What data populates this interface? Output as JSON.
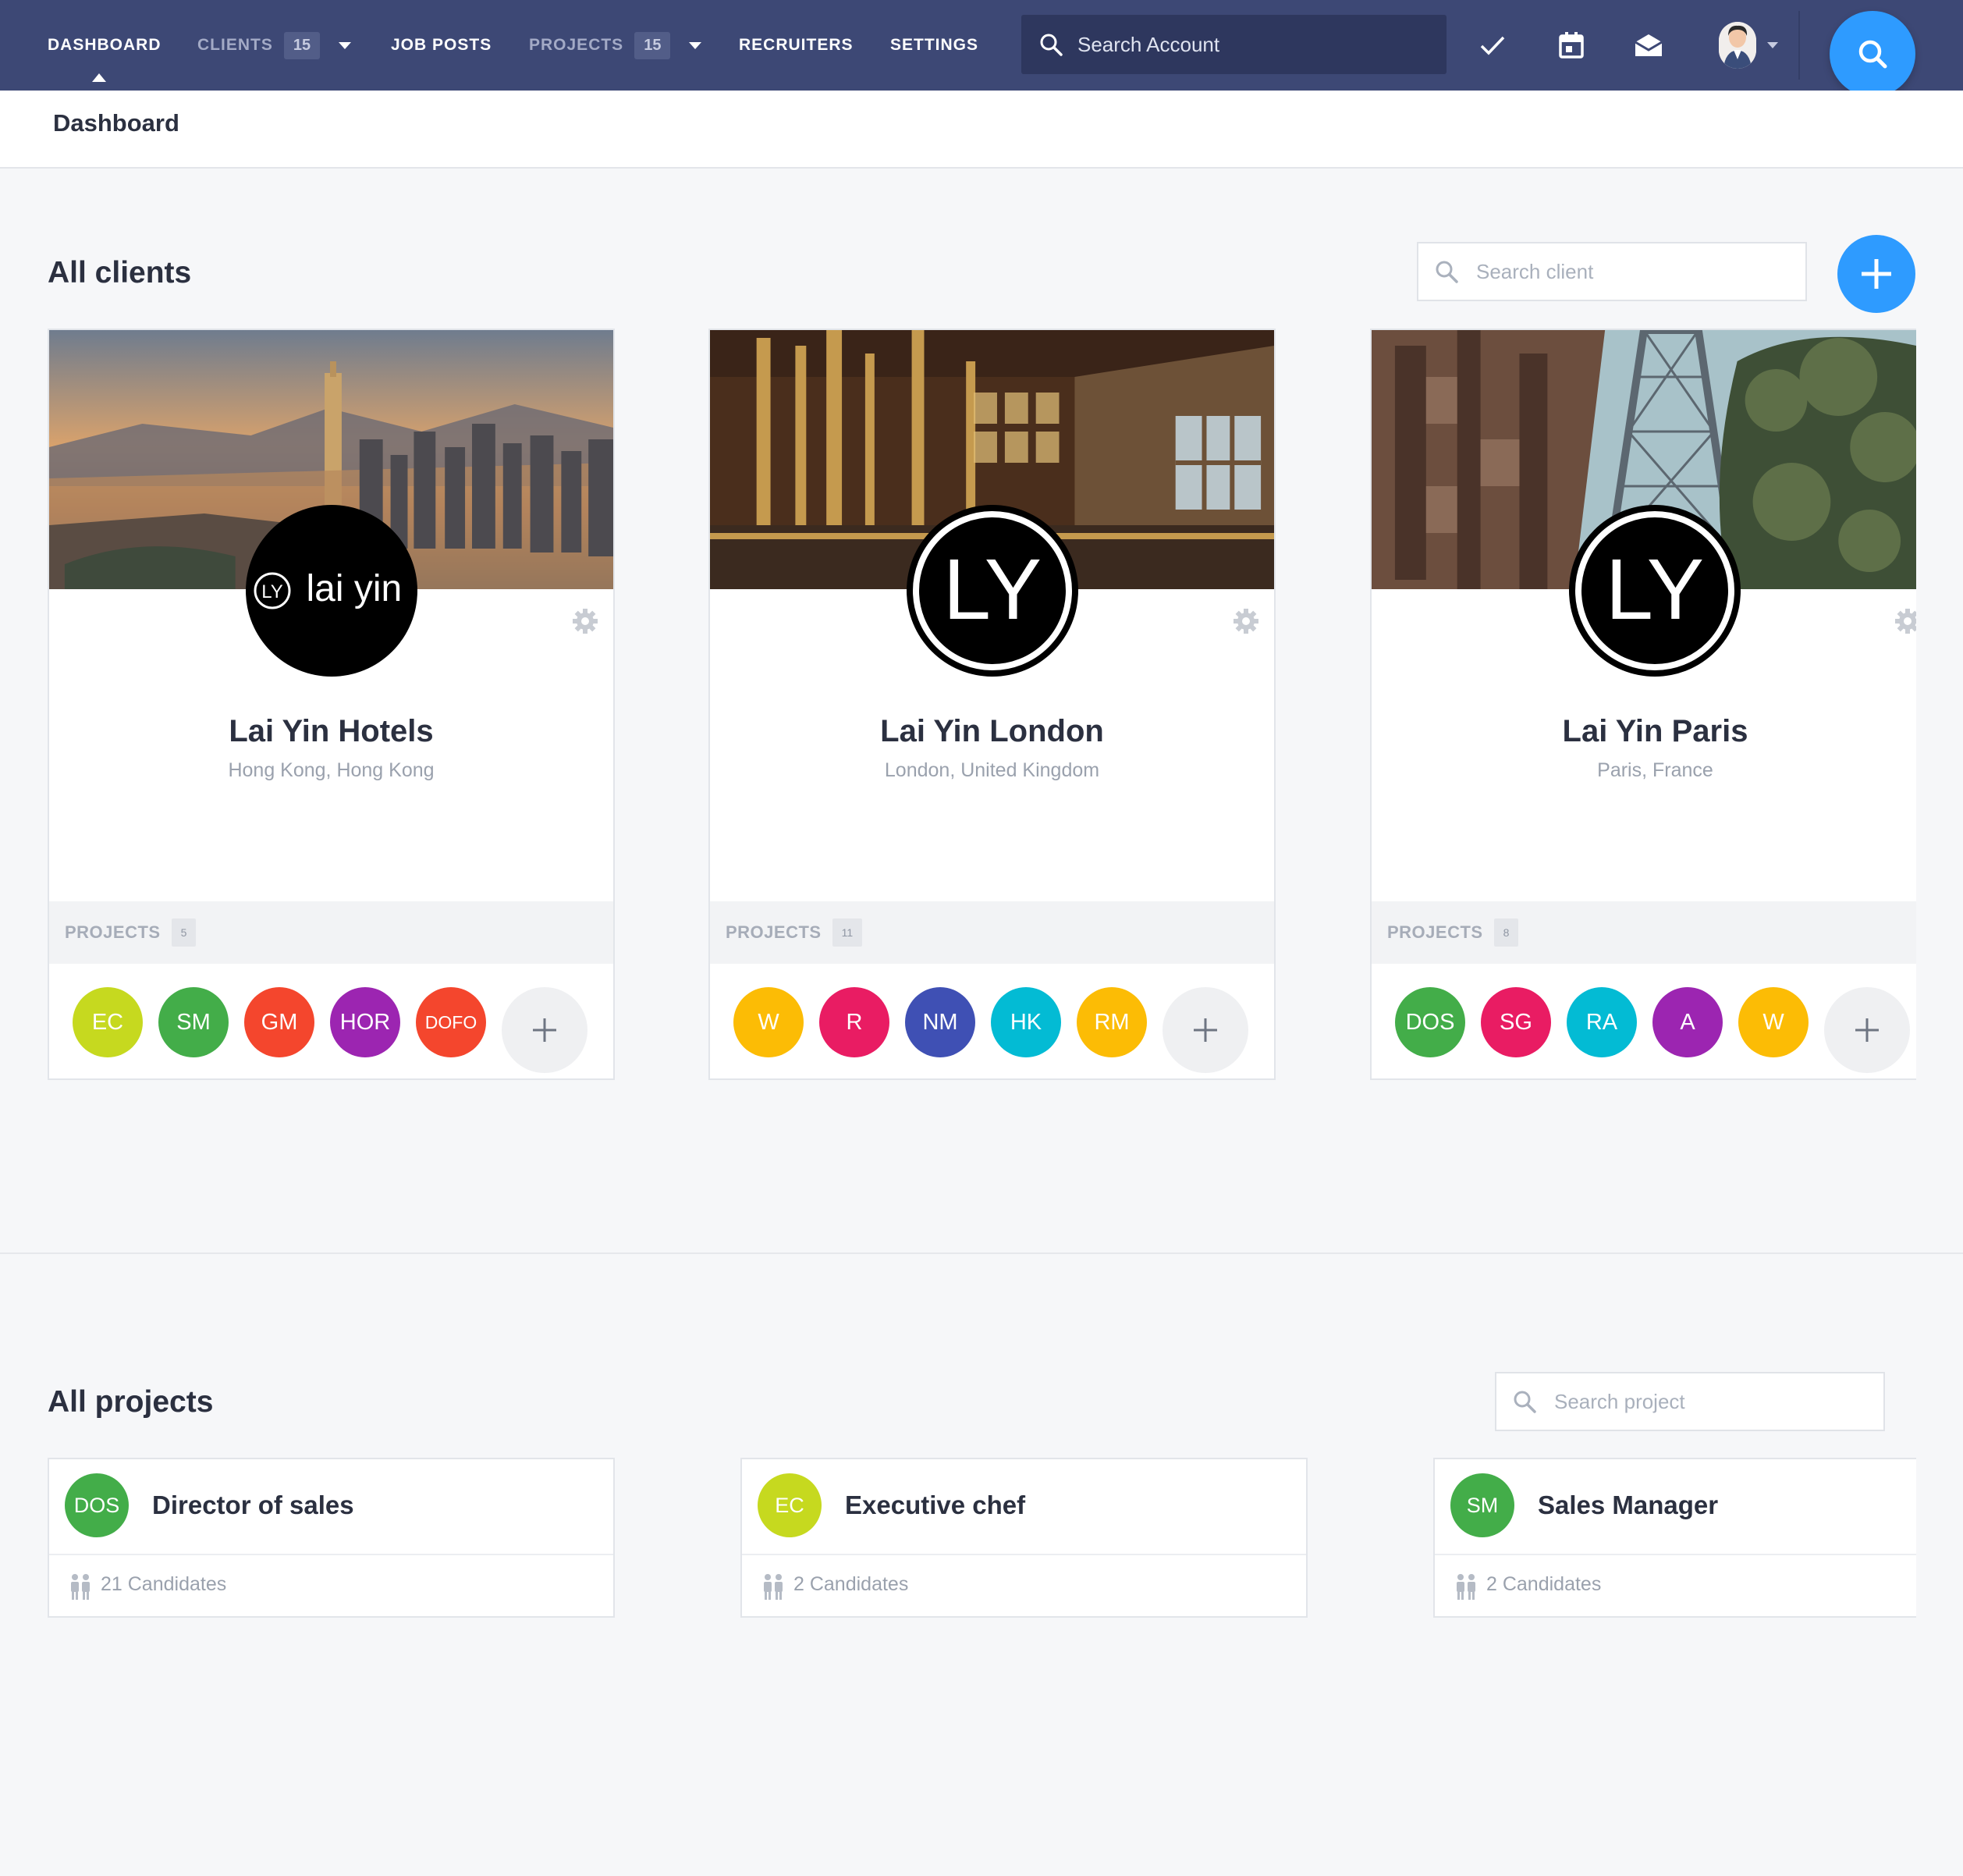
{
  "nav": {
    "dashboard": "DASHBOARD",
    "clients": "CLIENTS",
    "clients_count": "15",
    "job_posts": "JOB POSTS",
    "projects": "PROJECTS",
    "projects_count": "15",
    "recruiters": "RECRUITERS",
    "settings": "SETTINGS",
    "search_placeholder": "Search Account"
  },
  "page": {
    "title": "Dashboard"
  },
  "clients_section": {
    "title": "All clients",
    "search_placeholder": "Search client",
    "projects_label": "PROJECTS",
    "clients": [
      {
        "name": "Lai Yin Hotels",
        "location": "Hong Kong, Hong Kong",
        "projects_count": "5",
        "logo_text": "lai yin",
        "logo_mark": "LY",
        "members": [
          {
            "initials": "EC",
            "color": "#c6d91f"
          },
          {
            "initials": "SM",
            "color": "#43ad49"
          },
          {
            "initials": "GM",
            "color": "#f4462d"
          },
          {
            "initials": "HOR",
            "color": "#9c25b1"
          },
          {
            "initials": "DOFO",
            "color": "#f4462d"
          }
        ]
      },
      {
        "name": "Lai Yin London",
        "location": "London, United Kingdom",
        "projects_count": "11",
        "logo_mark": "LY",
        "members": [
          {
            "initials": "W",
            "color": "#fcbc05"
          },
          {
            "initials": "R",
            "color": "#e91c63"
          },
          {
            "initials": "NM",
            "color": "#3f50b4"
          },
          {
            "initials": "HK",
            "color": "#03bbd4"
          },
          {
            "initials": "RM",
            "color": "#fcbc05"
          }
        ]
      },
      {
        "name": "Lai Yin Paris",
        "location": "Paris, France",
        "projects_count": "8",
        "logo_mark": "LY",
        "members": [
          {
            "initials": "DOS",
            "color": "#43ad49"
          },
          {
            "initials": "SG",
            "color": "#e91c63"
          },
          {
            "initials": "RA",
            "color": "#03bbd4"
          },
          {
            "initials": "A",
            "color": "#9c25b1"
          },
          {
            "initials": "W",
            "color": "#fcbc05"
          }
        ]
      }
    ]
  },
  "projects_section": {
    "title": "All projects",
    "search_placeholder": "Search project",
    "projects": [
      {
        "initials": "DOS",
        "color": "#43ad49",
        "title": "Director of sales",
        "candidates": "21 Candidates"
      },
      {
        "initials": "EC",
        "color": "#c6d91f",
        "title": "Executive chef",
        "candidates": "2 Candidates"
      },
      {
        "initials": "SM",
        "color": "#43ad49",
        "title": "Sales Manager",
        "candidates": "2 Candidates"
      }
    ]
  },
  "colors": {
    "topbar": "#3d4875",
    "accent": "#2e9bff",
    "background": "#f6f7f9"
  },
  "icons": [
    "search-icon",
    "checkmark-icon",
    "calendar-icon",
    "mail-icon",
    "gear-icon",
    "plus-icon",
    "people-icon",
    "caret-down-icon"
  ]
}
